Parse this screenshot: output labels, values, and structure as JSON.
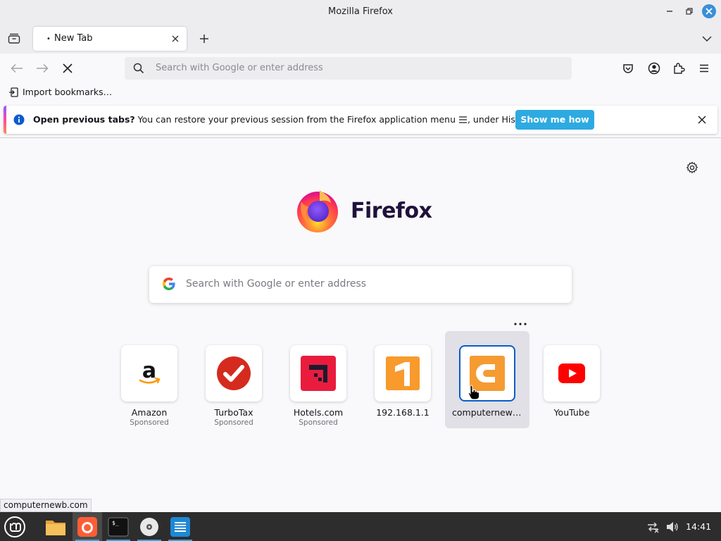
{
  "window": {
    "title": "Mozilla Firefox"
  },
  "tabs": [
    {
      "label": "New Tab"
    }
  ],
  "urlbar": {
    "placeholder": "Search with Google or enter address"
  },
  "bookmarks": {
    "import_label": "Import bookmarks…"
  },
  "notification": {
    "bold": "Open previous tabs?",
    "text_before_icon": " You can restore your previous session from the Firefox application menu ",
    "text_after_icon": ", under History.",
    "cta": "Show me how"
  },
  "newtab": {
    "brand": "Firefox",
    "search_placeholder": "Search with Google or enter address",
    "shortcuts": [
      {
        "name": "Amazon",
        "sub": "Sponsored",
        "icon": "amazon-logo"
      },
      {
        "name": "TurboTax",
        "sub": "Sponsored",
        "icon": "turbotax-logo"
      },
      {
        "name": "Hotels.com",
        "sub": "Sponsored",
        "icon": "hotels-logo"
      },
      {
        "name": "192.168.1.1",
        "sub": "",
        "icon": "router-logo"
      },
      {
        "name": "computernewb.com",
        "sub": "",
        "icon": "computernewb-logo"
      },
      {
        "name": "YouTube",
        "sub": "",
        "icon": "youtube-logo"
      }
    ]
  },
  "statusbar": {
    "text": "computernewb.com"
  },
  "taskbar": {
    "clock": "14:41"
  },
  "colors": {
    "accent": "#2daae1",
    "focus": "#0a5ccc",
    "brand_dark": "#20123a"
  }
}
